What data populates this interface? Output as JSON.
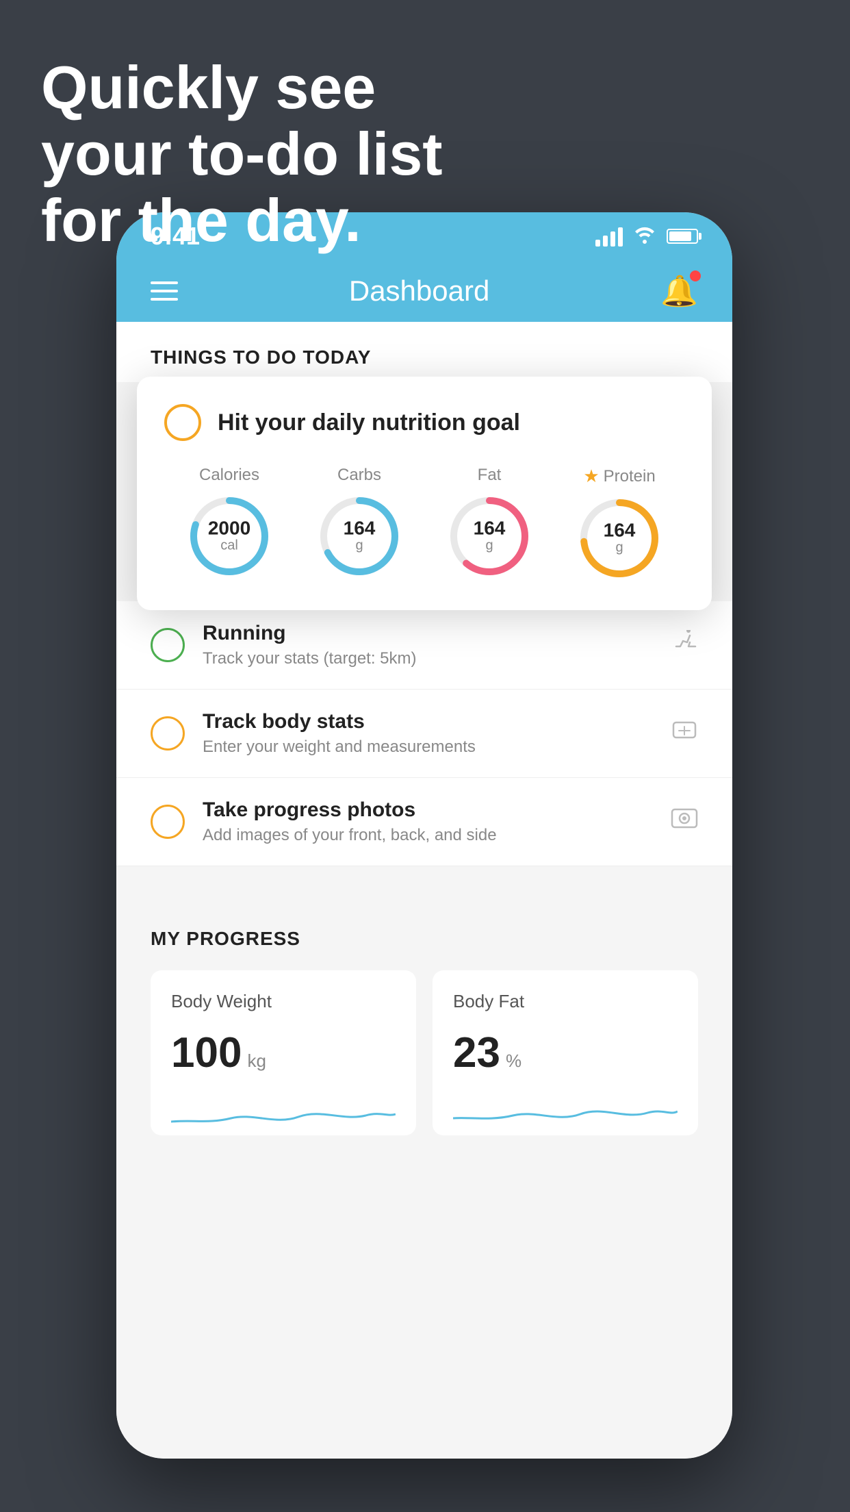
{
  "hero": {
    "title": "Quickly see\nyour to-do list\nfor the day."
  },
  "statusBar": {
    "time": "9:41",
    "signalBars": [
      12,
      18,
      24,
      30
    ],
    "showWifi": true,
    "showBattery": true
  },
  "navBar": {
    "title": "Dashboard"
  },
  "thingsToDoSection": {
    "title": "THINGS TO DO TODAY"
  },
  "nutritionCard": {
    "checkCircleColor": "#f5a623",
    "title": "Hit your daily nutrition goal",
    "items": [
      {
        "label": "Calories",
        "value": "2000",
        "unit": "cal",
        "color": "#58bde0",
        "starred": false
      },
      {
        "label": "Carbs",
        "value": "164",
        "unit": "g",
        "color": "#58bde0",
        "starred": false
      },
      {
        "label": "Fat",
        "value": "164",
        "unit": "g",
        "color": "#f06080",
        "starred": false
      },
      {
        "label": "Protein",
        "value": "164",
        "unit": "g",
        "color": "#f5a623",
        "starred": true
      }
    ]
  },
  "todoItems": [
    {
      "name": "Running",
      "desc": "Track your stats (target: 5km)",
      "circleColor": "green",
      "icon": "👟"
    },
    {
      "name": "Track body stats",
      "desc": "Enter your weight and measurements",
      "circleColor": "yellow",
      "icon": "⚖"
    },
    {
      "name": "Take progress photos",
      "desc": "Add images of your front, back, and side",
      "circleColor": "yellow",
      "icon": "🖼"
    }
  ],
  "progressSection": {
    "title": "MY PROGRESS",
    "cards": [
      {
        "title": "Body Weight",
        "value": "100",
        "unit": "kg"
      },
      {
        "title": "Body Fat",
        "value": "23",
        "unit": "%"
      }
    ]
  }
}
